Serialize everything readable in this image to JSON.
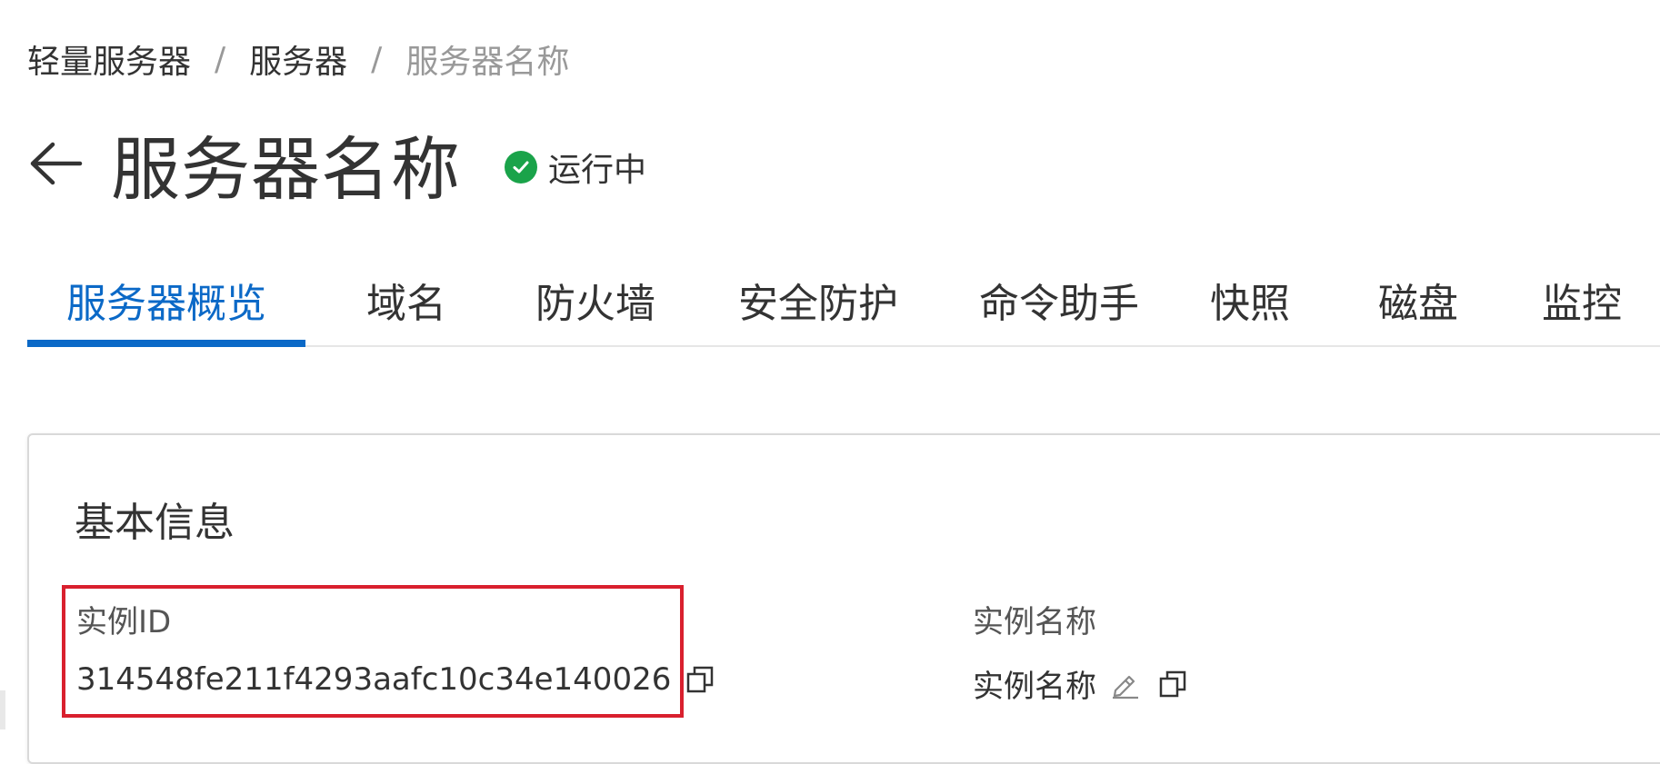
{
  "breadcrumb": {
    "items": [
      "轻量服务器",
      "服务器",
      "服务器名称"
    ],
    "separator": "/"
  },
  "header": {
    "title": "服务器名称",
    "status": {
      "label": "运行中",
      "color": "#1aa34a"
    }
  },
  "tabs": [
    {
      "label": "服务器概览",
      "active": true
    },
    {
      "label": "域名"
    },
    {
      "label": "防火墙"
    },
    {
      "label": "安全防护"
    },
    {
      "label": "命令助手"
    },
    {
      "label": "快照"
    },
    {
      "label": "磁盘"
    },
    {
      "label": "监控"
    }
  ],
  "basic_info": {
    "title": "基本信息",
    "instance_id": {
      "label": "实例ID",
      "value": "314548fe211f4293aafc10c34e140026"
    },
    "instance_name": {
      "label": "实例名称",
      "value": "实例名称"
    }
  },
  "colors": {
    "accent": "#0b69c7",
    "highlight": "#d9202e",
    "status_ok": "#1aa34a"
  },
  "icons": [
    "back-arrow-icon",
    "check-circle-icon",
    "copy-icon",
    "edit-pencil-icon"
  ]
}
